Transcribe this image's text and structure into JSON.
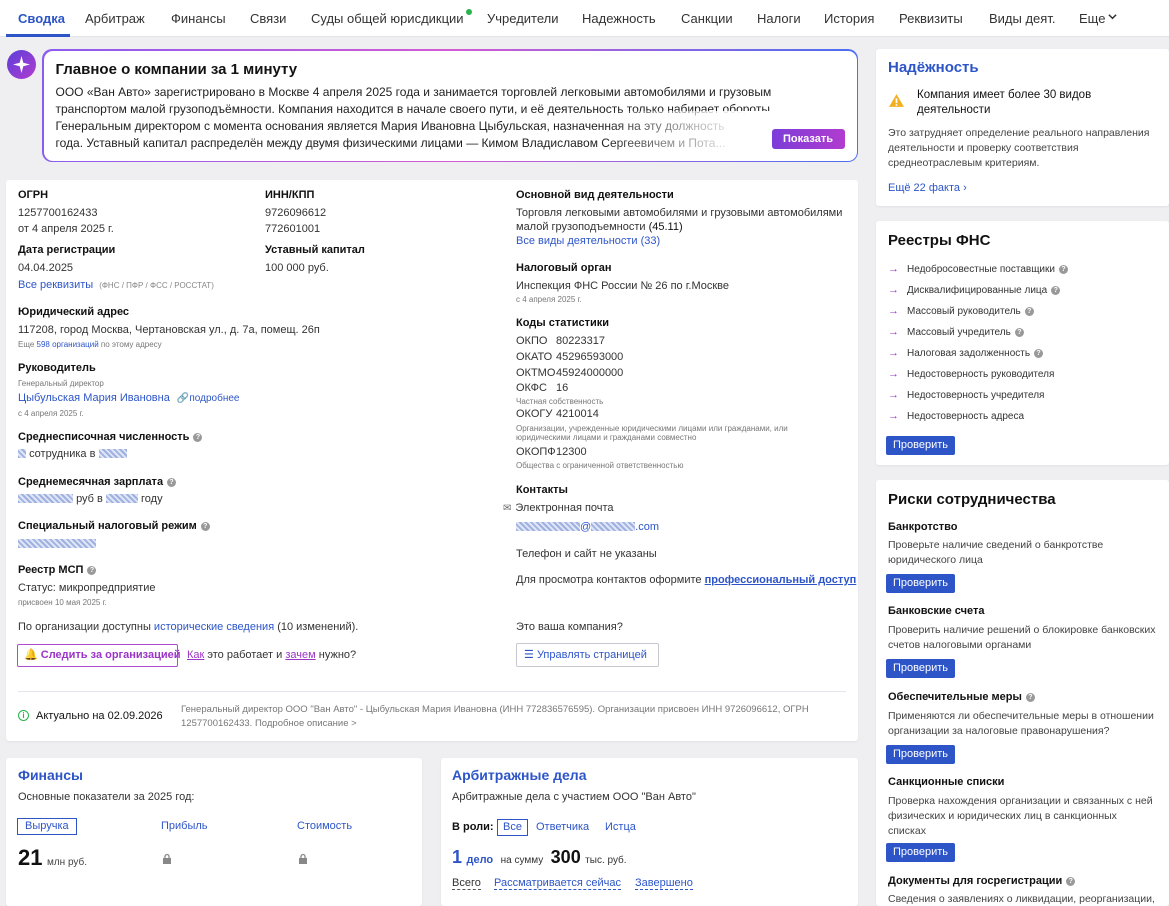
{
  "nav": {
    "tabs": [
      "Сводка",
      "Арбитраж",
      "Финансы",
      "Связи",
      "Суды общей юрисдикции",
      "Учредители",
      "Надежность",
      "Санкции",
      "Налоги",
      "История",
      "Реквизиты",
      "Виды деят.",
      "Еще"
    ]
  },
  "summary": {
    "title": "Главное о компании за 1 минуту",
    "line1": "ООО «Ван Авто» зарегистрировано в Москве 4 апреля 2025 года и занимается торговлей легковыми автомобилями и грузовым",
    "line2": "транспортом малой грузоподъёмности. Компания находится в начале своего пути, и её деятельность только набирает обороты.",
    "line3": "Генеральным директором с момента основания является Мария Ивановна Цыбульская, назначенная на эту должность",
    "line4": "года. Уставный капитал распределён между двумя физическими лицами — Кимом Владиславом Сергеевичем и Пота...",
    "button": "Показать"
  },
  "company": {
    "ogrn_label": "ОГРН",
    "ogrn": "1257700162433",
    "ogrn_date": "от 4 апреля 2025 г.",
    "inn_label": "ИНН/КПП",
    "inn": "9726096612",
    "kpp": "772601001",
    "reg_label": "Дата регистрации",
    "reg_date": "04.04.2025",
    "all_req": "Все реквизиты",
    "all_req_note": "(ФНС / ПФР / ФСС / РОССТАТ)",
    "capital_label": "Уставный капитал",
    "capital": "100 000 руб.",
    "address_label": "Юридический адрес",
    "address": "117208, город Москва, Чертановская ул., д. 7а, помещ. 26п",
    "address_note_pre": "Еще ",
    "address_note_link": "598 организаций",
    "address_note_post": " по этому адресу",
    "head_label": "Руководитель",
    "head_role": "Генеральный директор",
    "head_name": "Цыбульская Мария Ивановна",
    "head_more": "подробнее",
    "head_date": "с 4 апреля 2025 г.",
    "staff_label": "Среднесписочная численность",
    "staff_value": "сотрудника в",
    "salary_label": "Среднемесячная зарплата",
    "salary_mid": "руб в",
    "salary_end": "году",
    "tax_mode_label": "Специальный налоговый режим",
    "msp_label": "Реестр МСП",
    "msp_status": "Статус: микропредприятие",
    "msp_date": "присвоен 10 мая 2025 г.",
    "history_pre": "По организации доступны ",
    "history_link": "исторические сведения",
    "history_post": " (10 изменений).",
    "follow_btn": "Следить за организацией",
    "how_link": "Как",
    "how_mid": " это работает и ",
    "why_link": "зачем",
    "why_post": " нужно?",
    "activity_label": "Основной вид деятельности",
    "activity1": "Торговля легковыми автомобилями и грузовыми автомобилями",
    "activity2": "малой грузоподъемности",
    "activity_code": "(45.11)",
    "activities_all": "Все виды деятельности (33)",
    "tax_label": "Налоговый орган",
    "tax_org": "Инспекция ФНС России № 26 по г.Москве",
    "tax_date": "с 4 апреля 2025 г.",
    "stats_label": "Коды статистики",
    "okpo_k": "ОКПО",
    "okpo": "80223317",
    "okato_k": "ОКАТО",
    "okato": "45296593000",
    "oktmo_k": "ОКТМО",
    "oktmo": "45924000000",
    "okfs_k": "ОКФС",
    "okfs": "16",
    "okfs_note": "Частная собственность",
    "okogu_k": "ОКОГУ",
    "okogu": "4210014",
    "okogu_note1": "Организации, учрежденные юридическими лицами или гражданами, или",
    "okogu_note2": "юридическими лицами и гражданами совместно",
    "okopf_k": "ОКОПФ",
    "okopf": "12300",
    "okopf_note": "Общества с ограниченной ответственностью",
    "contacts_label": "Контакты",
    "email_label": "Электронная почта",
    "email_domain": "@",
    "email_tld": ".com",
    "phone_none": "Телефон и сайт не указаны",
    "contacts_pro_pre": "Для просмотра контактов оформите ",
    "contacts_pro_link": "профессиональный доступ",
    "your_company": "Это ваша компания?",
    "manage_btn": "Управлять страницей",
    "actual": "Актуально на 02.09.2026",
    "footer1": "Генеральный директор ООО \"Ван Авто\" - Цыбульская Мария Ивановна (ИНН 772836576595). Организации присвоен ИНН 9726096612, ОГРН",
    "footer2": "1257700162433. Подробное описание >"
  },
  "finance": {
    "title": "Финансы",
    "subtitle": "Основные показатели за 2025 год:",
    "tab_revenue": "Выручка",
    "tab_profit": "Прибыль",
    "tab_value": "Стоимость",
    "revenue": "21",
    "revenue_unit": "млн руб."
  },
  "arbitration": {
    "title": "Арбитражные дела",
    "subtitle": "Арбитражные дела с участием ООО \"Ван Авто\"",
    "roles_label": "В роли:",
    "role_all": "Все",
    "role_defendant": "Ответчика",
    "role_plaintiff": "Истца",
    "count": "1",
    "count_unit": "дело",
    "sum_pre": "на сумму",
    "sum": "300",
    "sum_unit": "тыс. руб.",
    "f_all": "Всего",
    "f_now": "Рассматривается сейчас",
    "f_done": "Завершено"
  },
  "reliability": {
    "title": "Надёжность",
    "warning1": "Компания имеет более 30 видов",
    "warning2": "деятельности",
    "desc1": "Это затрудняет определение реального направления",
    "desc2": "деятельности и проверку соответствия",
    "desc3": "среднеотраслевым критериям.",
    "more": "Ещё 22 факта"
  },
  "fns": {
    "title": "Реестры ФНС",
    "items": [
      "Недобросовестные поставщики",
      "Дисквалифицированные лица",
      "Массовый руководитель",
      "Массовый учредитель",
      "Налоговая задолженность",
      "Недостоверность руководителя",
      "Недостоверность учредителя",
      "Недостоверность адреса"
    ],
    "check": "Проверить"
  },
  "risks": {
    "title": "Риски сотрудничества",
    "bankruptcy_title": "Банкротство",
    "bankruptcy1": "Проверьте наличие сведений о банкротстве",
    "bankruptcy2": "юридического лица",
    "bank_title": "Банковские счета",
    "bank1": "Проверить наличие решений о блокировке банковских",
    "bank2": "счетов налоговыми органами",
    "measures_title": "Обеспечительные меры",
    "measures1": "Применяются ли обеспечительные меры в отношении",
    "measures2": "организации за налоговые правонарушения?",
    "sanctions_title": "Санкционные списки",
    "sanctions1": "Проверка нахождения организации и связанных с ней",
    "sanctions2": "физических и юридических лиц в санкционных",
    "sanctions3": "списках",
    "docs_title": "Документы для госрегистрации",
    "docs1": "Сведения о заявлениях о ликвидации, реорганизации,",
    "check": "Проверить"
  },
  "colors": {
    "accent": "#2d55c8",
    "purple": "#9b33c7",
    "warning": "#f2b01e"
  }
}
